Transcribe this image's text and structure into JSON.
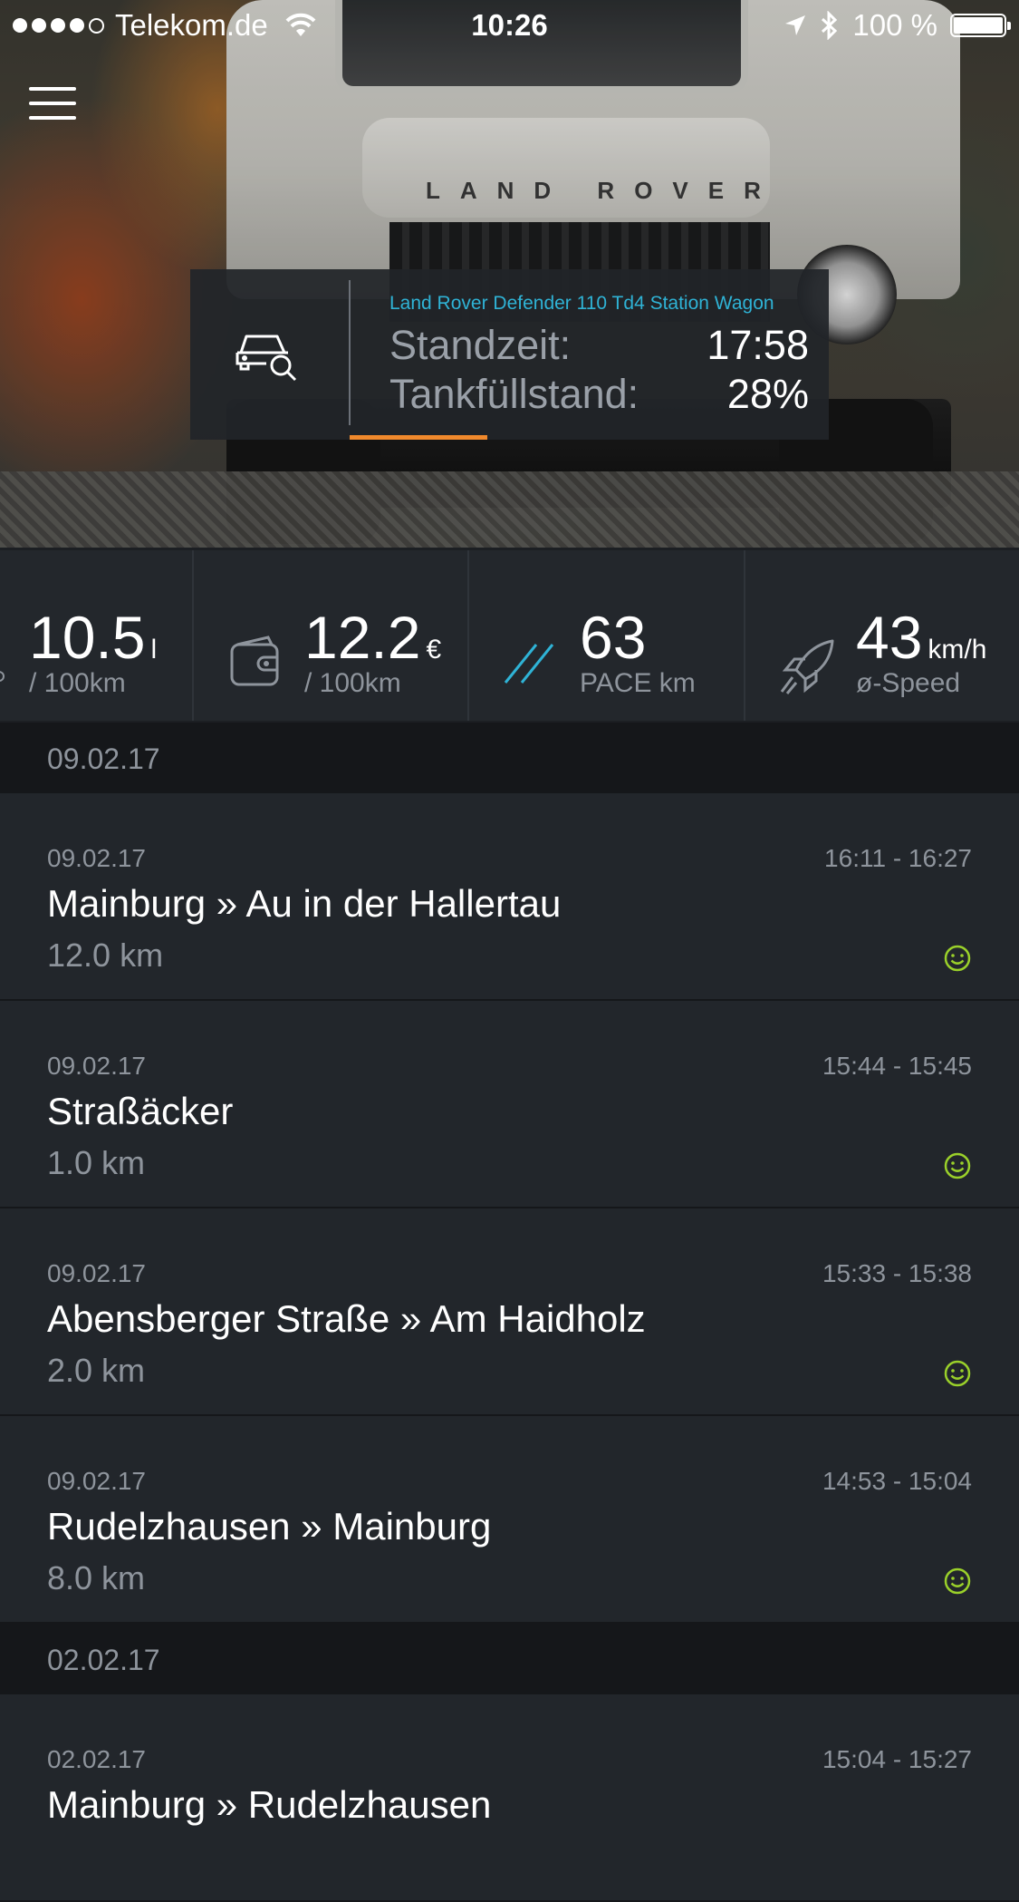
{
  "status_bar": {
    "carrier": "Telekom.de",
    "time": "10:26",
    "battery": "100 %"
  },
  "vehicle": {
    "model": "Land Rover Defender 110 Td4 Station Wagon",
    "standzeit_label": "Standzeit:",
    "standzeit_value": "17:58",
    "tank_label": "Tankfüllstand:",
    "tank_value": "28%"
  },
  "stats": [
    {
      "value": "10.5",
      "unit": "l",
      "sub": "/ 100km"
    },
    {
      "value": "12.2",
      "unit": "€",
      "sub": "/ 100km"
    },
    {
      "value": "63",
      "unit": "",
      "sub": "PACE km"
    },
    {
      "value": "43",
      "unit": "km/h",
      "sub": "ø-Speed"
    }
  ],
  "groups": [
    {
      "date": "09.02.17",
      "trips": [
        {
          "date": "09.02.17",
          "time": "16:11 - 16:27",
          "route": "Mainburg » Au in der Hallertau",
          "distance": "12.0 km"
        },
        {
          "date": "09.02.17",
          "time": "15:44 - 15:45",
          "route": "Straßäcker",
          "distance": "1.0 km"
        },
        {
          "date": "09.02.17",
          "time": "15:33 - 15:38",
          "route": "Abensberger Straße » Am Haidholz",
          "distance": "2.0 km"
        },
        {
          "date": "09.02.17",
          "time": "14:53 - 15:04",
          "route": "Rudelzhausen » Mainburg",
          "distance": "8.0 km"
        }
      ]
    },
    {
      "date": "02.02.17",
      "trips": [
        {
          "date": "02.02.17",
          "time": "15:04 - 15:27",
          "route": "Mainburg » Rudelzhausen",
          "distance": ""
        }
      ]
    }
  ],
  "colors": {
    "accent_blue": "#2fb3d6",
    "accent_orange": "#f0892c",
    "smiley_green": "#9ad02a"
  }
}
